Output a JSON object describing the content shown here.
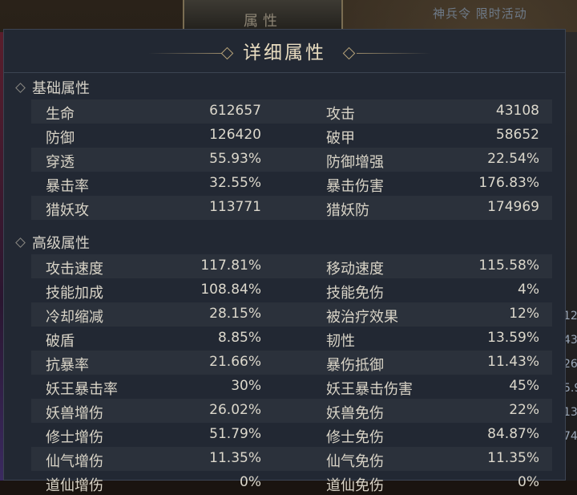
{
  "top_banner": {
    "label": "属性"
  },
  "top_right_text": "神兵令 限时活动",
  "right_strip": [
    "12",
    "43",
    "26",
    "5.9",
    "13",
    "74"
  ],
  "panel": {
    "title": "详细属性"
  },
  "basic": {
    "heading": "基础属性",
    "rows": [
      {
        "n1": "生命",
        "v1": "612657",
        "n2": "攻击",
        "v2": "43108"
      },
      {
        "n1": "防御",
        "v1": "126420",
        "n2": "破甲",
        "v2": "58652"
      },
      {
        "n1": "穿透",
        "v1": "55.93%",
        "n2": "防御增强",
        "v2": "22.54%"
      },
      {
        "n1": "暴击率",
        "v1": "32.55%",
        "n2": "暴击伤害",
        "v2": "176.83%"
      },
      {
        "n1": "猎妖攻",
        "v1": "113771",
        "n2": "猎妖防",
        "v2": "174969"
      }
    ]
  },
  "advanced": {
    "heading": "高级属性",
    "rows": [
      {
        "n1": "攻击速度",
        "v1": "117.81%",
        "n2": "移动速度",
        "v2": "115.58%"
      },
      {
        "n1": "技能加成",
        "v1": "108.84%",
        "n2": "技能免伤",
        "v2": "4%"
      },
      {
        "n1": "冷却缩减",
        "v1": "28.15%",
        "n2": "被治疗效果",
        "v2": "12%"
      },
      {
        "n1": "破盾",
        "v1": "8.85%",
        "n2": "韧性",
        "v2": "13.59%"
      },
      {
        "n1": "抗暴率",
        "v1": "21.66%",
        "n2": "暴伤抵御",
        "v2": "11.43%"
      },
      {
        "n1": "妖王暴击率",
        "v1": "30%",
        "n2": "妖王暴击伤害",
        "v2": "45%"
      },
      {
        "n1": "妖兽增伤",
        "v1": "26.02%",
        "n2": "妖兽免伤",
        "v2": "22%"
      },
      {
        "n1": "修士增伤",
        "v1": "51.79%",
        "n2": "修士免伤",
        "v2": "84.87%"
      },
      {
        "n1": "仙气增伤",
        "v1": "11.35%",
        "n2": "仙气免伤",
        "v2": "11.35%"
      },
      {
        "n1": "道仙增伤",
        "v1": "0%",
        "n2": "道仙免伤",
        "v2": "0%"
      }
    ]
  }
}
